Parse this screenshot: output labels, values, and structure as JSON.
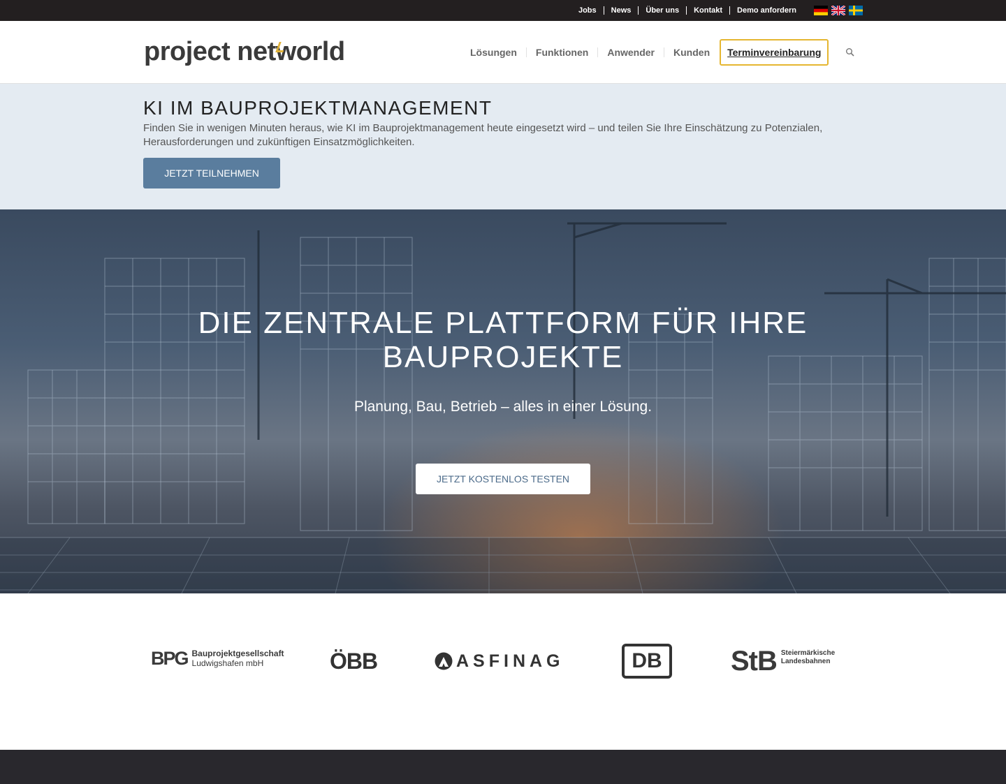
{
  "topbar": {
    "links": [
      "Jobs",
      "News",
      "Über uns",
      "Kontakt",
      "Demo anfordern"
    ],
    "flags": [
      "german-flag-icon",
      "uk-flag-icon",
      "swedish-flag-icon"
    ]
  },
  "header": {
    "logo": {
      "part1": "project net",
      "part2": "world"
    },
    "nav": [
      "Lösungen",
      "Funktionen",
      "Anwender",
      "Kunden"
    ],
    "cta": "Terminvereinbarung",
    "search_icon": "search-icon"
  },
  "banner": {
    "title": "KI IM BAUPROJEKTMANAGEMENT",
    "text": "Finden Sie in wenigen Minuten heraus, wie KI im Bauprojektmanagement heute eingesetzt wird – und teilen Sie Ihre Einschätzung zu Potenzialen, Herausforderungen und zukünftigen Einsatzmöglichkeiten.",
    "button": "JETZT TEILNEHMEN"
  },
  "hero": {
    "title": "DIE ZENTRALE PLATTFORM FÜR IHRE BAUPROJEKTE",
    "subtitle": "Planung, Bau, Betrieb – alles in einer Lösung.",
    "button": "JETZT KOSTENLOS TESTEN"
  },
  "customers": {
    "bpg": {
      "mark": "BPG",
      "line1": "Bauprojektgesellschaft",
      "line2": "Ludwigshafen mbH"
    },
    "obb": {
      "mark": "ÖBB"
    },
    "asfinag": {
      "mark": "ASFINAG"
    },
    "db": {
      "mark": "DB"
    },
    "stb": {
      "mark": "StB",
      "line1": "Steiermärkische",
      "line2": "Landesbahnen"
    }
  },
  "colors": {
    "topbar_bg": "#231f20",
    "accent": "#e5b630",
    "banner_bg": "#e4ebf2",
    "banner_button": "#5a7d9e",
    "footer_bg": "#29282d"
  }
}
